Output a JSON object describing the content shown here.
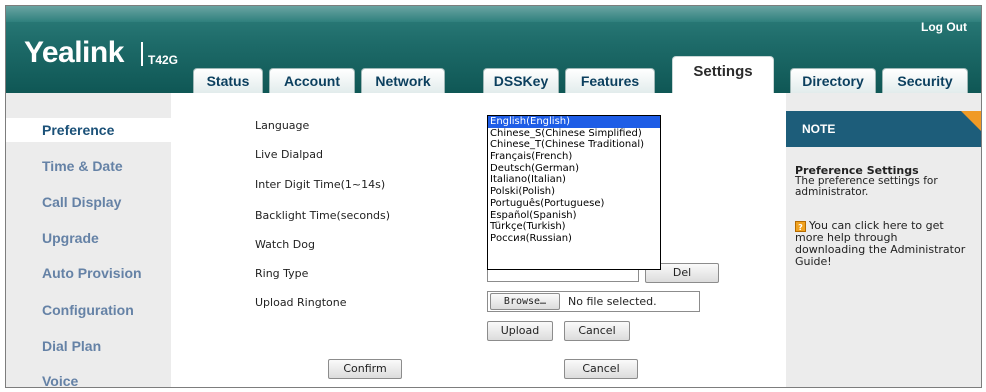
{
  "header": {
    "logo": "Yealink",
    "model": "T42G",
    "logout": "Log Out"
  },
  "tabs": [
    {
      "label": "Status"
    },
    {
      "label": "Account"
    },
    {
      "label": "Network"
    },
    {
      "label": "DSSKey"
    },
    {
      "label": "Features"
    },
    {
      "label": "Settings",
      "active": true
    },
    {
      "label": "Directory"
    },
    {
      "label": "Security"
    }
  ],
  "sidebar": {
    "items": [
      {
        "label": "Preference",
        "active": true
      },
      {
        "label": "Time & Date"
      },
      {
        "label": "Call Display"
      },
      {
        "label": "Upgrade"
      },
      {
        "label": "Auto Provision"
      },
      {
        "label": "Configuration"
      },
      {
        "label": "Dial Plan"
      },
      {
        "label": "Voice"
      }
    ]
  },
  "form": {
    "language_label": "Language",
    "live_dialpad_label": "Live Dialpad",
    "inter_digit_label": "Inter Digit Time(1~14s)",
    "backlight_label": "Backlight Time(seconds)",
    "watchdog_label": "Watch Dog",
    "ring_type_label": "Ring Type",
    "upload_ringtone_label": "Upload Ringtone",
    "del_button": "Del",
    "browse_button": "Browse…",
    "file_status": "No file selected.",
    "upload_button": "Upload",
    "upload_cancel_button": "Cancel",
    "confirm_button": "Confirm",
    "cancel_button": "Cancel"
  },
  "language_dropdown": {
    "selected": "English(English)",
    "options": [
      "English(English)",
      "Chinese_S(Chinese Simplified)",
      "Chinese_T(Chinese Traditional)",
      "Français(French)",
      "Deutsch(German)",
      "Italiano(Italian)",
      "Polski(Polish)",
      "Português(Portuguese)",
      "Español(Spanish)",
      "Türkçe(Turkish)",
      "Россия(Russian)"
    ]
  },
  "note": {
    "title": "NOTE",
    "heading": "Preference Settings",
    "line1": "The preference settings for",
    "line2": "administrator.",
    "help1": "You can click here to get",
    "help2": "more help through",
    "help3": "downloading the Administrator",
    "help4": "Guide!",
    "help_icon_glyph": "?"
  },
  "colors": {
    "header": "#1d6a68",
    "nav_text": "#6582a6",
    "note_header": "#1d5d7a",
    "note_accent": "#f09a25",
    "selection": "#1e5de6"
  }
}
